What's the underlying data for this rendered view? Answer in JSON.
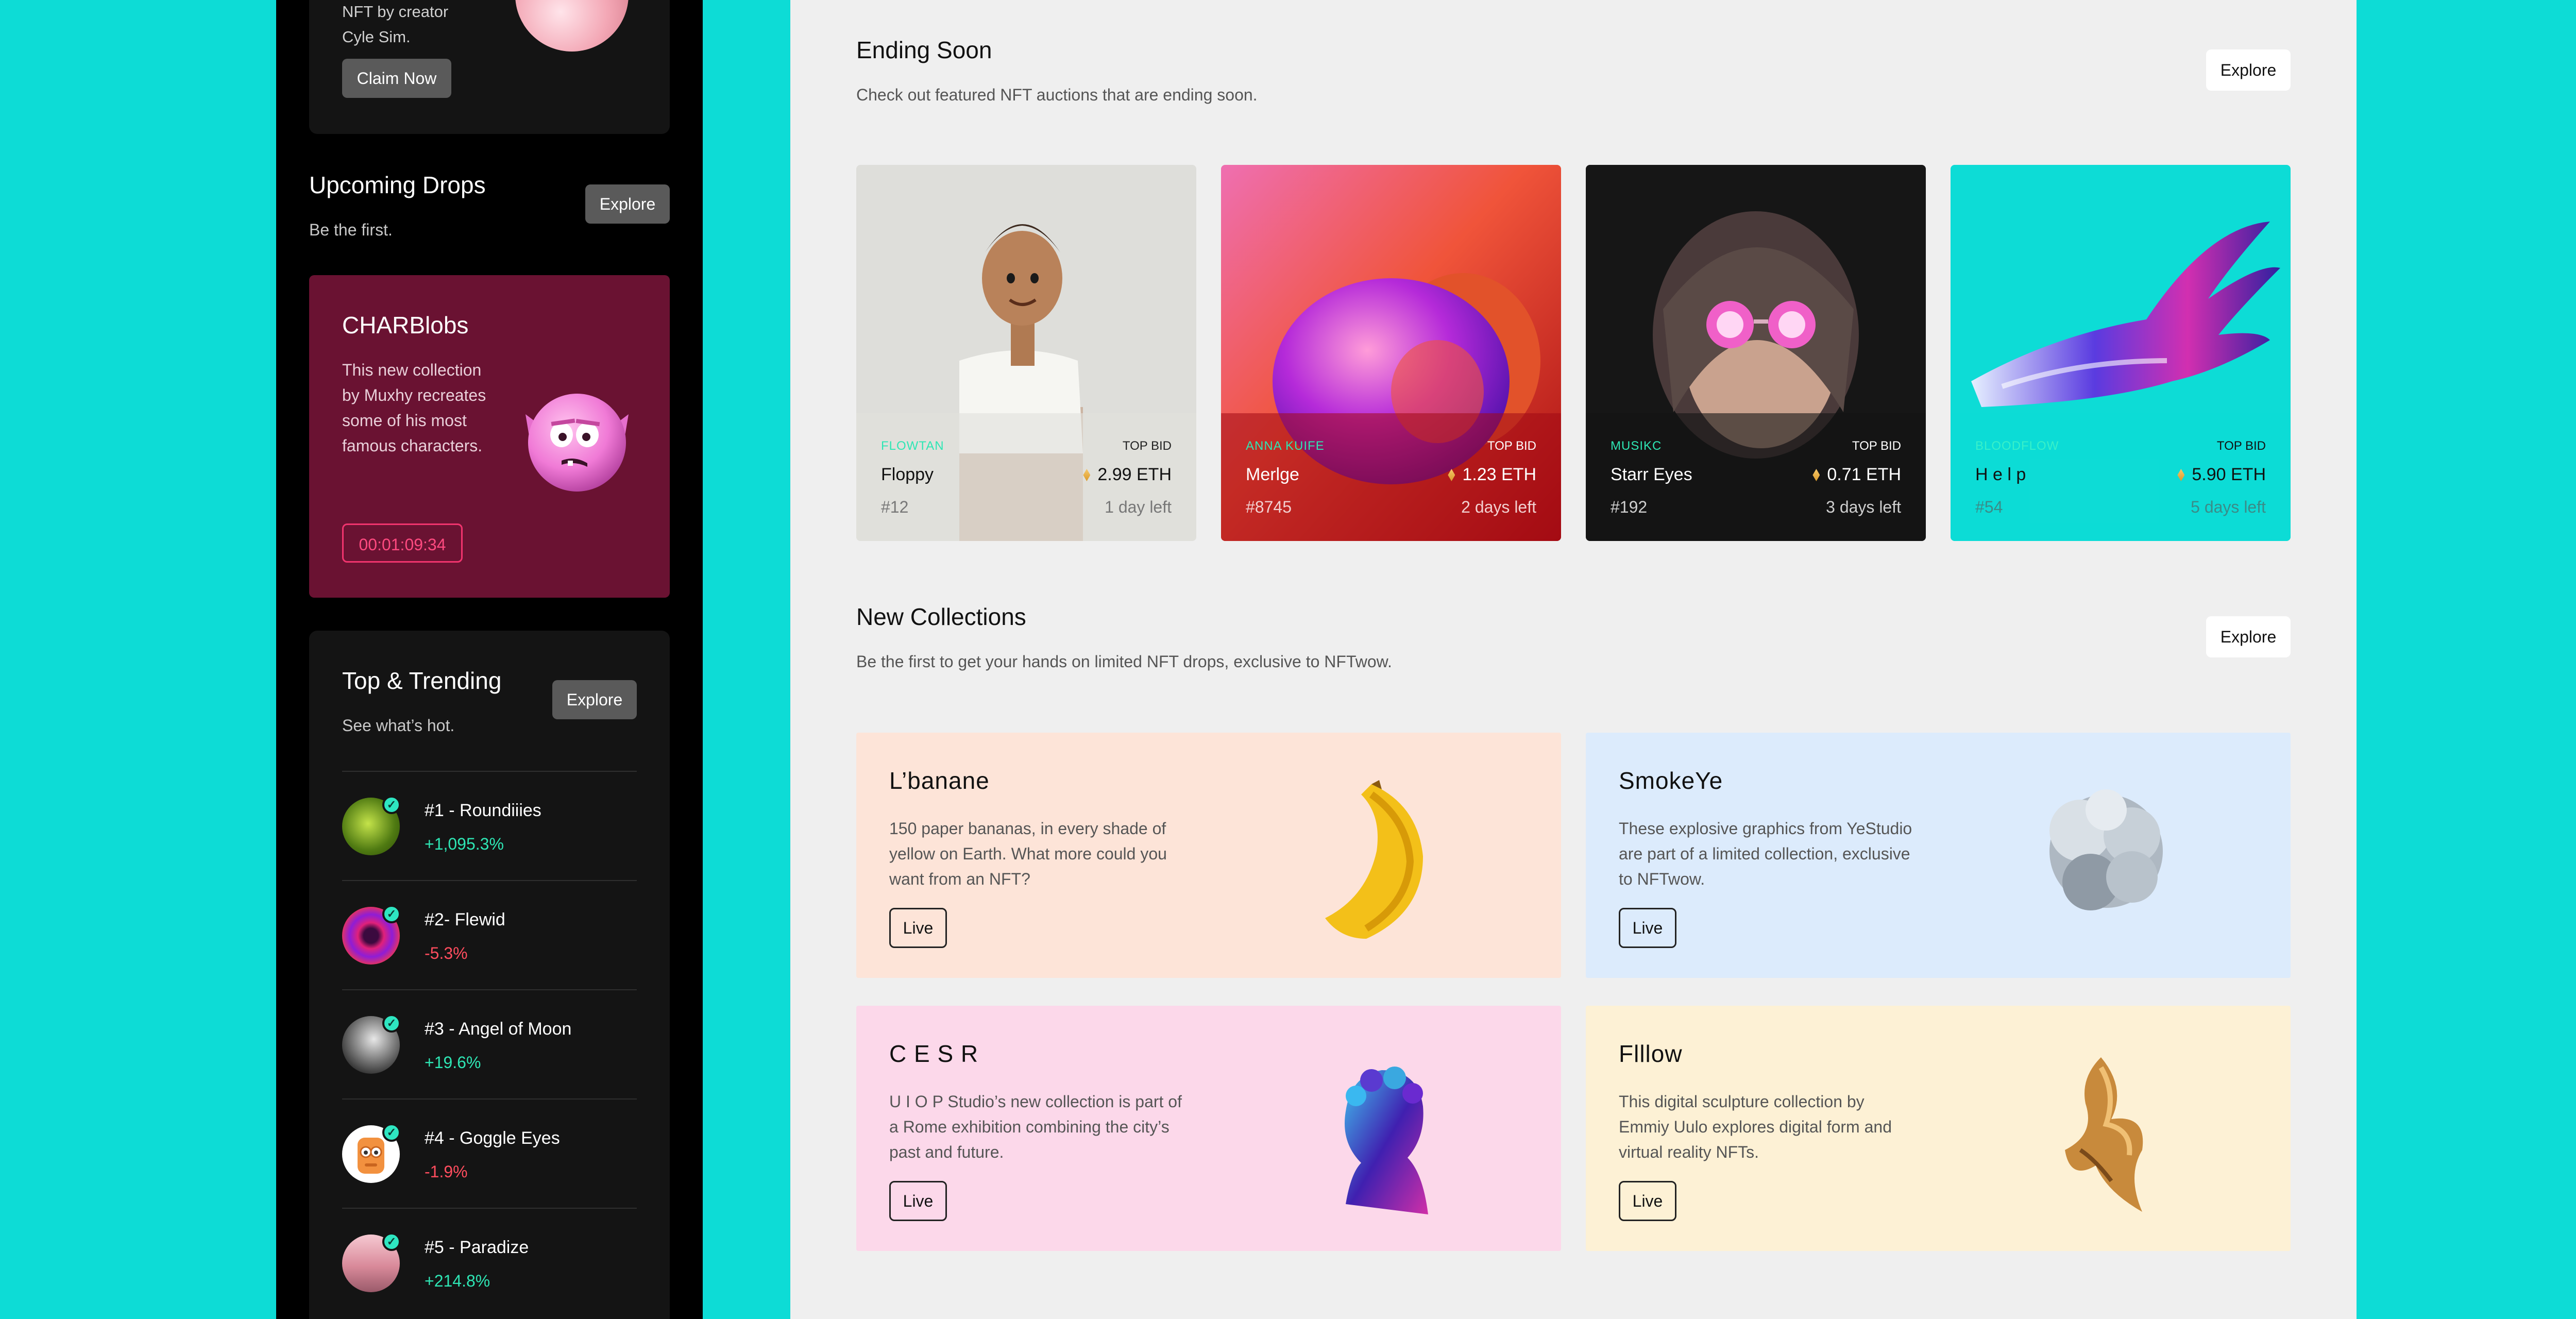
{
  "sidebar": {
    "promo": {
      "line1": "NFT by creator",
      "line2": "Cyle Sim.",
      "button": "Claim Now"
    },
    "upcoming": {
      "title": "Upcoming Drops",
      "subtitle": "Be the first.",
      "explore": "Explore",
      "card": {
        "title": "CHARBlobs",
        "description": "This new collection by Muxhy recreates some of his most famous characters.",
        "timer": "00:01:09:34"
      }
    },
    "trending": {
      "title": "Top & Trending",
      "subtitle": "See what’s hot.",
      "explore": "Explore",
      "items": [
        {
          "name": "#1 - Roundiiies",
          "change": "+1,095.3%",
          "trend": "up"
        },
        {
          "name": "#2- Flewid",
          "change": "-5.3%",
          "trend": "down"
        },
        {
          "name": "#3 - Angel of Moon",
          "change": "+19.6%",
          "trend": "up"
        },
        {
          "name": "#4 - Goggle Eyes",
          "change": "-1.9%",
          "trend": "down"
        },
        {
          "name": "#5 - Paradize",
          "change": "+214.8%",
          "trend": "up"
        }
      ]
    }
  },
  "ending_soon": {
    "title": "Ending Soon",
    "subtitle": "Check out featured NFT auctions that are ending soon.",
    "explore": "Explore",
    "cards": [
      {
        "artist": "FLOWTAN",
        "top_bid_label": "TOP BID",
        "name": "Floppy",
        "price": "2.99 ETH",
        "id": "#12",
        "time_left": "1 day left"
      },
      {
        "artist": "ANNA KUIFE",
        "top_bid_label": "TOP BID",
        "name": "Merlge",
        "price": "1.23 ETH",
        "id": "#8745",
        "time_left": "2 days left"
      },
      {
        "artist": "MUSIKC",
        "top_bid_label": "TOP BID",
        "name": "Starr Eyes",
        "price": "0.71 ETH",
        "id": "#192",
        "time_left": "3 days left"
      },
      {
        "artist": "BLOODFLOW",
        "top_bid_label": "TOP BID",
        "name": "H e l p",
        "price": "5.90 ETH",
        "id": "#54",
        "time_left": "5 days left"
      }
    ]
  },
  "new_collections": {
    "title": "New Collections",
    "subtitle": "Be the first to get your hands on limited NFT drops, exclusive to NFTwow.",
    "explore": "Explore",
    "cards": [
      {
        "title": "L’banane",
        "description": "150 paper bananas, in every shade of yellow on Earth. What more could you want from an NFT?",
        "button": "Live",
        "background": "#fde4d8"
      },
      {
        "title": "SmokeYe",
        "description": "These explosive graphics from YeStudio are part of a limited collection, exclusive to NFTwow.",
        "button": "Live",
        "background": "#dcebfc"
      },
      {
        "title": "C E S R",
        "description": "U I O P Studio’s new collection is part of a Rome exhibition combining the city’s past and future.",
        "button": "Live",
        "background": "#fcd8ea"
      },
      {
        "title": "Flllow",
        "description": "This digital sculpture collection by Emmiy Uulo explores digital form and virtual reality NFTs.",
        "button": "Live",
        "background": "#fdf1d5"
      }
    ]
  },
  "colors": {
    "page_background": "#0ddcd6",
    "sidebar_background": "#000000",
    "main_background": "#efefef",
    "positive": "#2ee6b4",
    "negative": "#ff4d5e",
    "timer": "#ff4a80"
  }
}
